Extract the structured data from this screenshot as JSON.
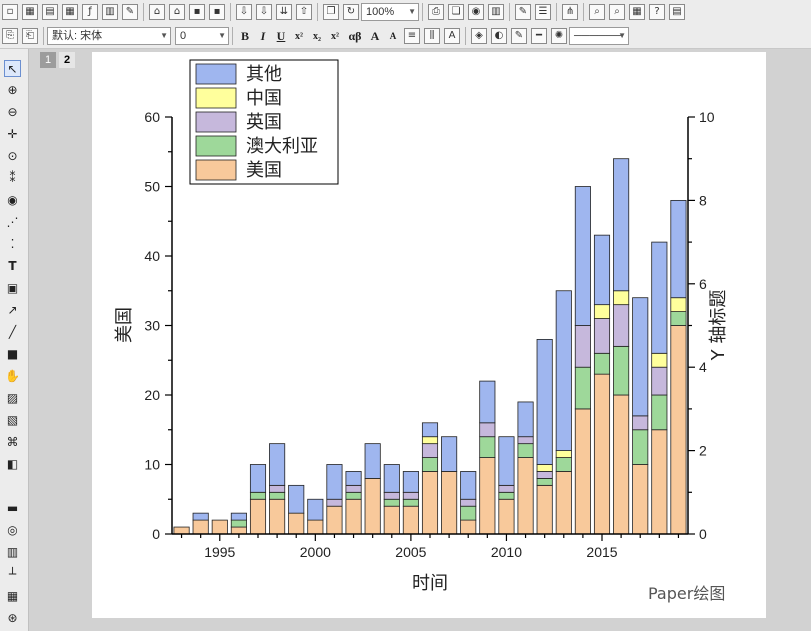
{
  "toolbar": {
    "zoom_value": "100%",
    "font_name": "默认: 宋体",
    "font_size": "0",
    "bold_label": "B",
    "italic_label": "I",
    "underline_label": "U",
    "superscript_label": "x²",
    "subscript_label": "x₂",
    "supsub_label": "x²",
    "greek_label": "αβ",
    "increase_font_label": "A",
    "decrease_font_label": "A"
  },
  "layers": {
    "tab1": "1",
    "tab2": "2"
  },
  "watermark": "Paper绘图",
  "colors": {
    "us": "#f8c99b",
    "australia": "#9ed89a",
    "uk": "#c6b8dc",
    "china": "#ffff9c",
    "other": "#9fb6ef",
    "arrow": "#e6262a"
  },
  "chart_data": {
    "type": "bar",
    "stacked": true,
    "xlabel": "时间",
    "ylabel": "美国",
    "y2label": "Y 轴标题",
    "ylim": [
      0,
      60
    ],
    "y2lim": [
      0,
      10
    ],
    "xticks": [
      1995,
      2000,
      2005,
      2010,
      2015
    ],
    "yticks": [
      0,
      10,
      20,
      30,
      40,
      50,
      60
    ],
    "y2ticks": [
      0,
      2,
      4,
      6,
      8,
      10
    ],
    "legend_position": "top-left",
    "categories": [
      1993,
      1994,
      1995,
      1996,
      1997,
      1998,
      1999,
      2000,
      2001,
      2002,
      2003,
      2004,
      2005,
      2006,
      2007,
      2008,
      2009,
      2010,
      2011,
      2012,
      2013,
      2014,
      2015,
      2016,
      2017,
      2018,
      2019
    ],
    "series": [
      {
        "name": "美国",
        "values": [
          1,
          2,
          2,
          1,
          5,
          5,
          3,
          2,
          4,
          5,
          8,
          4,
          4,
          9,
          9,
          2,
          11,
          5,
          11,
          7,
          9,
          18,
          23,
          20,
          10,
          15,
          30
        ]
      },
      {
        "name": "澳大利亚",
        "values": [
          0,
          0,
          0,
          1,
          1,
          1,
          0,
          0,
          0,
          1,
          0,
          1,
          1,
          2,
          0,
          2,
          3,
          1,
          2,
          1,
          2,
          6,
          3,
          7,
          5,
          5,
          2
        ]
      },
      {
        "name": "英国",
        "values": [
          0,
          0,
          0,
          0,
          0,
          1,
          0,
          0,
          1,
          1,
          0,
          1,
          1,
          2,
          0,
          1,
          2,
          1,
          1,
          1,
          0,
          6,
          5,
          6,
          2,
          4,
          0
        ]
      },
      {
        "name": "中国",
        "values": [
          0,
          0,
          0,
          0,
          0,
          0,
          0,
          0,
          0,
          0,
          0,
          0,
          0,
          1,
          0,
          0,
          0,
          0,
          0,
          1,
          1,
          0,
          2,
          2,
          0,
          2,
          2
        ]
      },
      {
        "name": "其他",
        "values": [
          0,
          1,
          0,
          1,
          4,
          6,
          4,
          3,
          5,
          2,
          5,
          4,
          3,
          2,
          5,
          4,
          6,
          7,
          5,
          18,
          23,
          20,
          10,
          19,
          17,
          16,
          14
        ]
      }
    ],
    "legend_order": [
      "其他",
      "中国",
      "英国",
      "澳大利亚",
      "美国"
    ]
  }
}
